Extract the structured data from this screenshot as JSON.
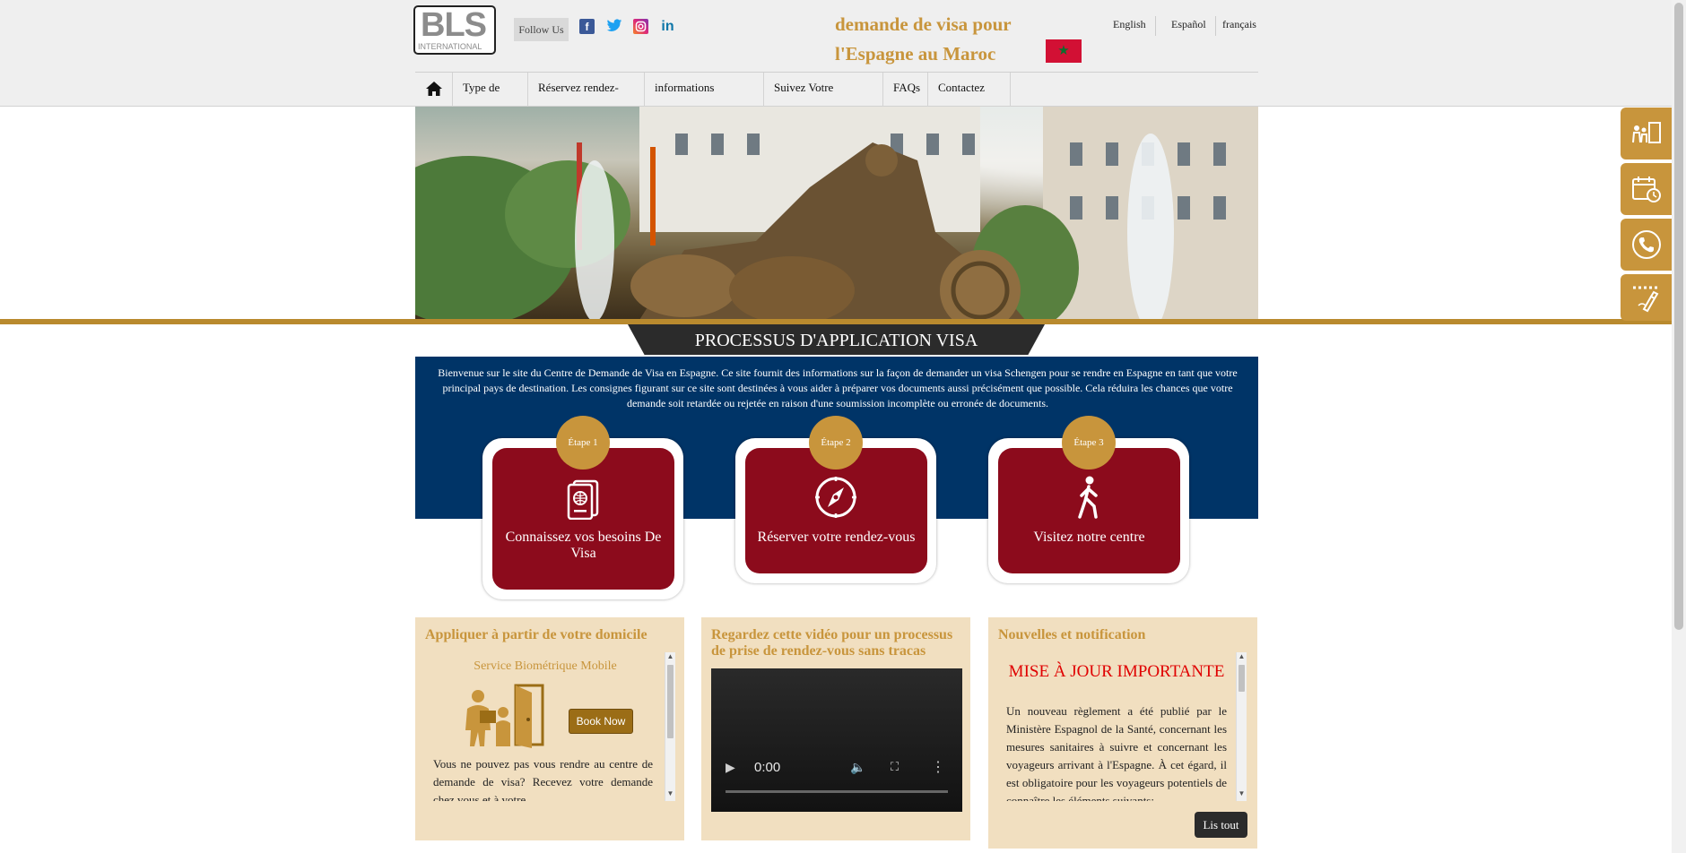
{
  "header": {
    "logo_text": "BLS",
    "logo_sub": "INTERNATIONAL",
    "follow_label": "Follow Us",
    "social": [
      "facebook-icon",
      "twitter-icon",
      "instagram-icon",
      "linkedin-icon"
    ],
    "title": "demande de visa pour l'Espagne au Maroc",
    "languages": [
      "English",
      "Español",
      "français"
    ]
  },
  "nav": {
    "items": [
      "Type de visa",
      "Réservez rendez-vous",
      "informations générales",
      "Suivez Votre Demande",
      "FAQs",
      "Contactez nous"
    ]
  },
  "process": {
    "title": "PROCESSUS D'APPLICATION VISA",
    "intro": "Bienvenue sur le site du Centre de Demande de Visa en Espagne. Ce site fournit des informations sur la façon de demander un visa Schengen pour se rendre en Espagne en tant que votre principal pays de destination. Les consignes figurant sur ce site sont destinées à vous aider à préparer vos documents aussi précisément que possible. Cela réduira les chances que votre demande soit retardée ou rejetée en raison d'une soumission incomplète ou erronée de documents.",
    "steps": [
      {
        "badge": "Étape 1",
        "label": "Connaissez vos besoins De Visa",
        "icon": "passport-icon"
      },
      {
        "badge": "Étape 2",
        "label": "Réserver votre rendez-vous",
        "icon": "compass-icon"
      },
      {
        "badge": "Étape 3",
        "label": "Visitez notre centre",
        "icon": "walking-person-icon"
      }
    ]
  },
  "panels": {
    "home": {
      "title": "Appliquer à partir de votre domicile",
      "subtitle": "Service Biométrique Mobile",
      "button": "Book Now",
      "text1": "Vous ne pouvez pas vous rendre au centre de demande de visa?",
      "text2": "Recevez votre demande chez vous et à votre"
    },
    "video": {
      "title": "Regardez cette vidéo pour un processus de prise de rendez-vous sans tracas",
      "time": "0:00"
    },
    "news": {
      "title": "Nouvelles et notification",
      "headline": "MISE À JOUR IMPORTANTE",
      "text": "Un nouveau règlement a été publié par le Ministère Espagnol de la Santé, concernant les mesures sanitaires à suivre et concernant les voyageurs arrivant à l'Espagne. À cet égard, il est obligatoire pour les voyageurs potentiels de connaître les éléments suivants:",
      "button": "Lis tout"
    }
  },
  "colors": {
    "gold": "#c8953c",
    "navy": "#003467",
    "red": "#8c0b1c",
    "panel_bg": "#f1dfc0"
  },
  "side_tabs": [
    "family-visa-icon",
    "calendar-clock-icon",
    "phone-icon",
    "rating-feedback-icon"
  ]
}
